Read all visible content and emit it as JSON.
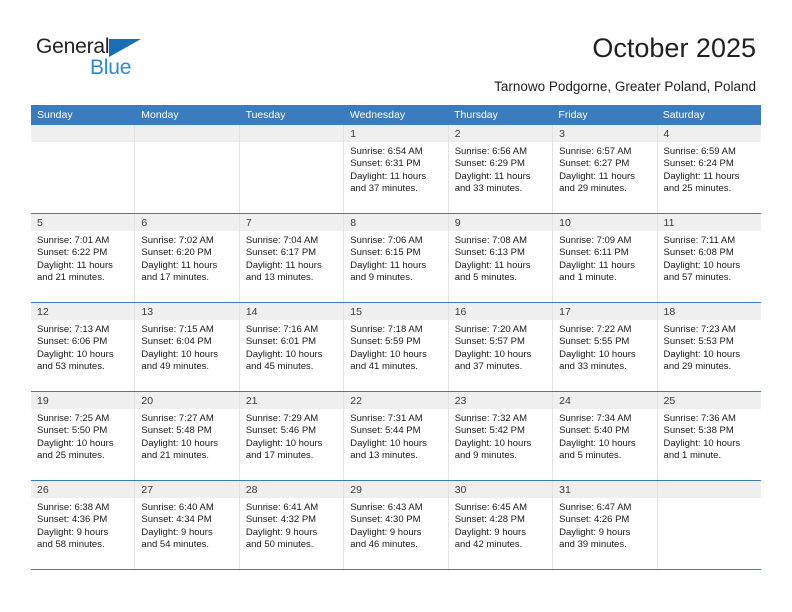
{
  "brand": {
    "name_top": "General",
    "name_bottom": "Blue",
    "triangle_icon": "triangle-logo-icon",
    "color_dark": "#231f20",
    "color_blue": "#2b8ad6"
  },
  "header": {
    "title": "October 2025",
    "subtitle": "Tarnowo Podgorne, Greater Poland, Poland"
  },
  "theme": {
    "header_bg": "#3b7cbf",
    "header_text": "#ffffff",
    "daynum_bg": "#efefef",
    "cell_bg": "#ffffff",
    "row_divider": "#3b7cbf",
    "cell_divider": "#e3e3e3"
  },
  "calendar": {
    "weekdays": [
      "Sunday",
      "Monday",
      "Tuesday",
      "Wednesday",
      "Thursday",
      "Friday",
      "Saturday"
    ],
    "weeks": [
      [
        {
          "day": "",
          "sunrise": "",
          "sunset": "",
          "daylight": "",
          "daylight2": ""
        },
        {
          "day": "",
          "sunrise": "",
          "sunset": "",
          "daylight": "",
          "daylight2": ""
        },
        {
          "day": "",
          "sunrise": "",
          "sunset": "",
          "daylight": "",
          "daylight2": ""
        },
        {
          "day": "1",
          "sunrise": "Sunrise: 6:54 AM",
          "sunset": "Sunset: 6:31 PM",
          "daylight": "Daylight: 11 hours",
          "daylight2": "and 37 minutes."
        },
        {
          "day": "2",
          "sunrise": "Sunrise: 6:56 AM",
          "sunset": "Sunset: 6:29 PM",
          "daylight": "Daylight: 11 hours",
          "daylight2": "and 33 minutes."
        },
        {
          "day": "3",
          "sunrise": "Sunrise: 6:57 AM",
          "sunset": "Sunset: 6:27 PM",
          "daylight": "Daylight: 11 hours",
          "daylight2": "and 29 minutes."
        },
        {
          "day": "4",
          "sunrise": "Sunrise: 6:59 AM",
          "sunset": "Sunset: 6:24 PM",
          "daylight": "Daylight: 11 hours",
          "daylight2": "and 25 minutes."
        }
      ],
      [
        {
          "day": "5",
          "sunrise": "Sunrise: 7:01 AM",
          "sunset": "Sunset: 6:22 PM",
          "daylight": "Daylight: 11 hours",
          "daylight2": "and 21 minutes."
        },
        {
          "day": "6",
          "sunrise": "Sunrise: 7:02 AM",
          "sunset": "Sunset: 6:20 PM",
          "daylight": "Daylight: 11 hours",
          "daylight2": "and 17 minutes."
        },
        {
          "day": "7",
          "sunrise": "Sunrise: 7:04 AM",
          "sunset": "Sunset: 6:17 PM",
          "daylight": "Daylight: 11 hours",
          "daylight2": "and 13 minutes."
        },
        {
          "day": "8",
          "sunrise": "Sunrise: 7:06 AM",
          "sunset": "Sunset: 6:15 PM",
          "daylight": "Daylight: 11 hours",
          "daylight2": "and 9 minutes."
        },
        {
          "day": "9",
          "sunrise": "Sunrise: 7:08 AM",
          "sunset": "Sunset: 6:13 PM",
          "daylight": "Daylight: 11 hours",
          "daylight2": "and 5 minutes."
        },
        {
          "day": "10",
          "sunrise": "Sunrise: 7:09 AM",
          "sunset": "Sunset: 6:11 PM",
          "daylight": "Daylight: 11 hours",
          "daylight2": "and 1 minute."
        },
        {
          "day": "11",
          "sunrise": "Sunrise: 7:11 AM",
          "sunset": "Sunset: 6:08 PM",
          "daylight": "Daylight: 10 hours",
          "daylight2": "and 57 minutes."
        }
      ],
      [
        {
          "day": "12",
          "sunrise": "Sunrise: 7:13 AM",
          "sunset": "Sunset: 6:06 PM",
          "daylight": "Daylight: 10 hours",
          "daylight2": "and 53 minutes."
        },
        {
          "day": "13",
          "sunrise": "Sunrise: 7:15 AM",
          "sunset": "Sunset: 6:04 PM",
          "daylight": "Daylight: 10 hours",
          "daylight2": "and 49 minutes."
        },
        {
          "day": "14",
          "sunrise": "Sunrise: 7:16 AM",
          "sunset": "Sunset: 6:01 PM",
          "daylight": "Daylight: 10 hours",
          "daylight2": "and 45 minutes."
        },
        {
          "day": "15",
          "sunrise": "Sunrise: 7:18 AM",
          "sunset": "Sunset: 5:59 PM",
          "daylight": "Daylight: 10 hours",
          "daylight2": "and 41 minutes."
        },
        {
          "day": "16",
          "sunrise": "Sunrise: 7:20 AM",
          "sunset": "Sunset: 5:57 PM",
          "daylight": "Daylight: 10 hours",
          "daylight2": "and 37 minutes."
        },
        {
          "day": "17",
          "sunrise": "Sunrise: 7:22 AM",
          "sunset": "Sunset: 5:55 PM",
          "daylight": "Daylight: 10 hours",
          "daylight2": "and 33 minutes."
        },
        {
          "day": "18",
          "sunrise": "Sunrise: 7:23 AM",
          "sunset": "Sunset: 5:53 PM",
          "daylight": "Daylight: 10 hours",
          "daylight2": "and 29 minutes."
        }
      ],
      [
        {
          "day": "19",
          "sunrise": "Sunrise: 7:25 AM",
          "sunset": "Sunset: 5:50 PM",
          "daylight": "Daylight: 10 hours",
          "daylight2": "and 25 minutes."
        },
        {
          "day": "20",
          "sunrise": "Sunrise: 7:27 AM",
          "sunset": "Sunset: 5:48 PM",
          "daylight": "Daylight: 10 hours",
          "daylight2": "and 21 minutes."
        },
        {
          "day": "21",
          "sunrise": "Sunrise: 7:29 AM",
          "sunset": "Sunset: 5:46 PM",
          "daylight": "Daylight: 10 hours",
          "daylight2": "and 17 minutes."
        },
        {
          "day": "22",
          "sunrise": "Sunrise: 7:31 AM",
          "sunset": "Sunset: 5:44 PM",
          "daylight": "Daylight: 10 hours",
          "daylight2": "and 13 minutes."
        },
        {
          "day": "23",
          "sunrise": "Sunrise: 7:32 AM",
          "sunset": "Sunset: 5:42 PM",
          "daylight": "Daylight: 10 hours",
          "daylight2": "and 9 minutes."
        },
        {
          "day": "24",
          "sunrise": "Sunrise: 7:34 AM",
          "sunset": "Sunset: 5:40 PM",
          "daylight": "Daylight: 10 hours",
          "daylight2": "and 5 minutes."
        },
        {
          "day": "25",
          "sunrise": "Sunrise: 7:36 AM",
          "sunset": "Sunset: 5:38 PM",
          "daylight": "Daylight: 10 hours",
          "daylight2": "and 1 minute."
        }
      ],
      [
        {
          "day": "26",
          "sunrise": "Sunrise: 6:38 AM",
          "sunset": "Sunset: 4:36 PM",
          "daylight": "Daylight: 9 hours",
          "daylight2": "and 58 minutes."
        },
        {
          "day": "27",
          "sunrise": "Sunrise: 6:40 AM",
          "sunset": "Sunset: 4:34 PM",
          "daylight": "Daylight: 9 hours",
          "daylight2": "and 54 minutes."
        },
        {
          "day": "28",
          "sunrise": "Sunrise: 6:41 AM",
          "sunset": "Sunset: 4:32 PM",
          "daylight": "Daylight: 9 hours",
          "daylight2": "and 50 minutes."
        },
        {
          "day": "29",
          "sunrise": "Sunrise: 6:43 AM",
          "sunset": "Sunset: 4:30 PM",
          "daylight": "Daylight: 9 hours",
          "daylight2": "and 46 minutes."
        },
        {
          "day": "30",
          "sunrise": "Sunrise: 6:45 AM",
          "sunset": "Sunset: 4:28 PM",
          "daylight": "Daylight: 9 hours",
          "daylight2": "and 42 minutes."
        },
        {
          "day": "31",
          "sunrise": "Sunrise: 6:47 AM",
          "sunset": "Sunset: 4:26 PM",
          "daylight": "Daylight: 9 hours",
          "daylight2": "and 39 minutes."
        },
        {
          "day": "",
          "sunrise": "",
          "sunset": "",
          "daylight": "",
          "daylight2": ""
        }
      ]
    ]
  }
}
